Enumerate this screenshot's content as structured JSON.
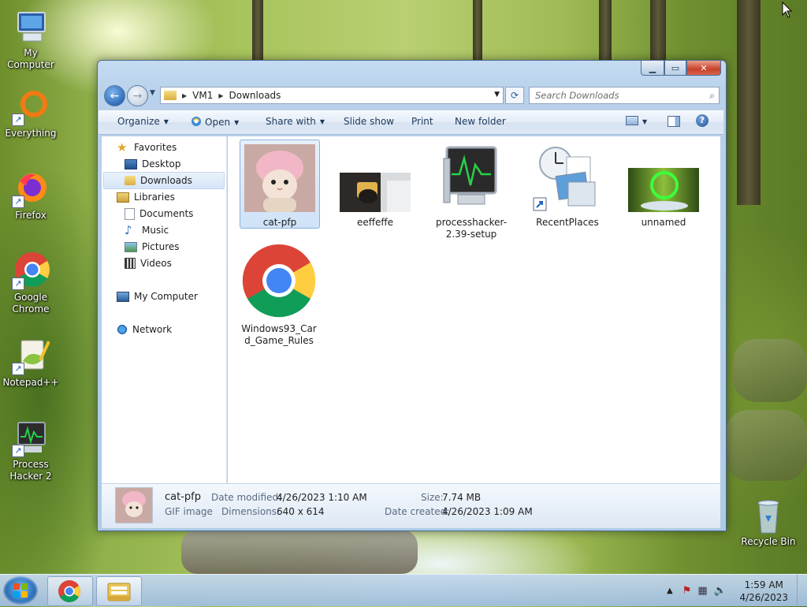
{
  "desktop": {
    "icons": [
      {
        "label": "My Computer"
      },
      {
        "label": "Everything"
      },
      {
        "label": "Firefox"
      },
      {
        "label": "Google Chrome"
      },
      {
        "label": "Notepad++"
      },
      {
        "label": "Process Hacker 2"
      },
      {
        "label": "Recycle Bin"
      }
    ]
  },
  "window": {
    "breadcrumb": [
      "VM1",
      "Downloads"
    ],
    "search_placeholder": "Search Downloads",
    "commands": {
      "organize": "Organize",
      "open": "Open",
      "share_with": "Share with",
      "slide_show": "Slide show",
      "print": "Print",
      "new_folder": "New folder"
    },
    "nav": {
      "favorites": "Favorites",
      "desktop": "Desktop",
      "downloads": "Downloads",
      "libraries": "Libraries",
      "documents": "Documents",
      "music": "Music",
      "pictures": "Pictures",
      "videos": "Videos",
      "my_computer": "My Computer",
      "network": "Network"
    },
    "files": [
      {
        "name": "cat-pfp",
        "selected": true
      },
      {
        "name": "eeffeffe"
      },
      {
        "name": "processhacker-2.39-setup"
      },
      {
        "name": "RecentPlaces"
      },
      {
        "name": "unnamed"
      },
      {
        "name": "Windows93_Card_Game_Rules"
      }
    ],
    "details": {
      "name": "cat-pfp",
      "type": "GIF image",
      "date_modified_label": "Date modified:",
      "date_modified": "4/26/2023 1:10 AM",
      "dimensions_label": "Dimensions:",
      "dimensions": "640 x 614",
      "size_label": "Size:",
      "size": "7.74 MB",
      "date_created_label": "Date created:",
      "date_created": "4/26/2023 1:09 AM"
    }
  },
  "taskbar": {
    "time": "1:59 AM",
    "date": "4/26/2023"
  }
}
